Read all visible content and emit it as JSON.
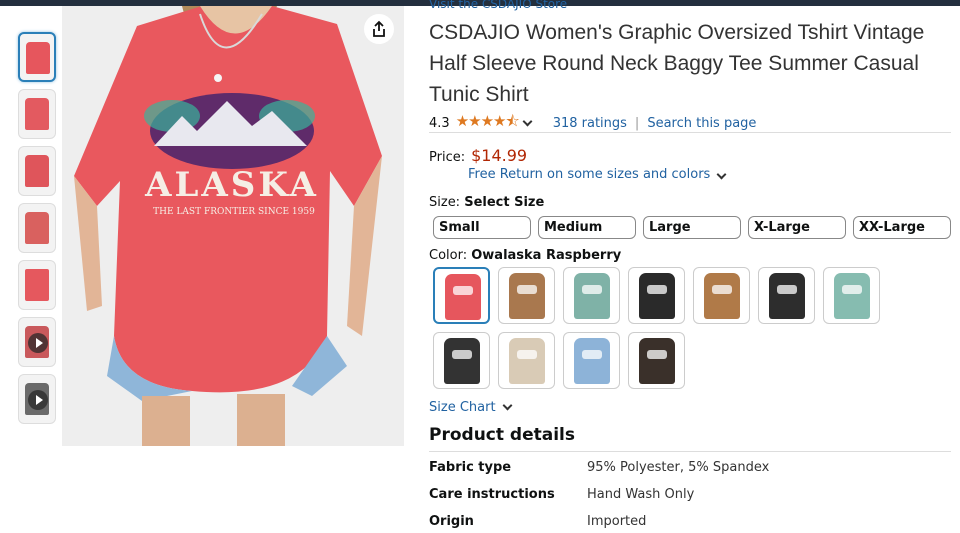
{
  "store_link": "Visit the CSDAJIO Store",
  "title": "CSDAJIO Women's Graphic Oversized Tshirt Vintage Half Sleeve Round Neck Baggy Tee Summer Casual Tunic Shirt",
  "rating": {
    "value": "4.3",
    "stars": "★★★★⯪",
    "count": "318 ratings",
    "separator": "|",
    "search_link": "Search this page"
  },
  "price": {
    "label": "Price:",
    "value": "$14.99",
    "returns": "Free Return on some sizes and colors"
  },
  "size": {
    "label": "Size:",
    "selected": "Select Size",
    "options": [
      "Small",
      "Medium",
      "Large",
      "X-Large",
      "XX-Large"
    ]
  },
  "color": {
    "label": "Color:",
    "selected": "Owalaska Raspberry",
    "swatches": [
      "#e6565d",
      "#a9784e",
      "#7fb2a7",
      "#2a2a2a",
      "#b07a48",
      "#2d2d2d",
      "#86bcb0",
      "#333333",
      "#d9cbb6",
      "#8db3d8",
      "#3a302a"
    ]
  },
  "size_chart": "Size Chart",
  "main_image": {
    "text1": "ALASKA",
    "text2": "THE LAST FRONTIER SINCE 1959"
  },
  "product_details": {
    "title": "Product details",
    "rows": [
      {
        "key": "Fabric type",
        "value": "95% Polyester, 5% Spandex"
      },
      {
        "key": "Care instructions",
        "value": "Hand Wash Only"
      },
      {
        "key": "Origin",
        "value": "Imported"
      }
    ]
  },
  "colors": {
    "link": "#2162a1",
    "price": "#b12704",
    "star": "#de7921",
    "accent": "#2a7fb8"
  },
  "icons": [
    "share-icon",
    "chevron-down-icon",
    "play-icon"
  ]
}
